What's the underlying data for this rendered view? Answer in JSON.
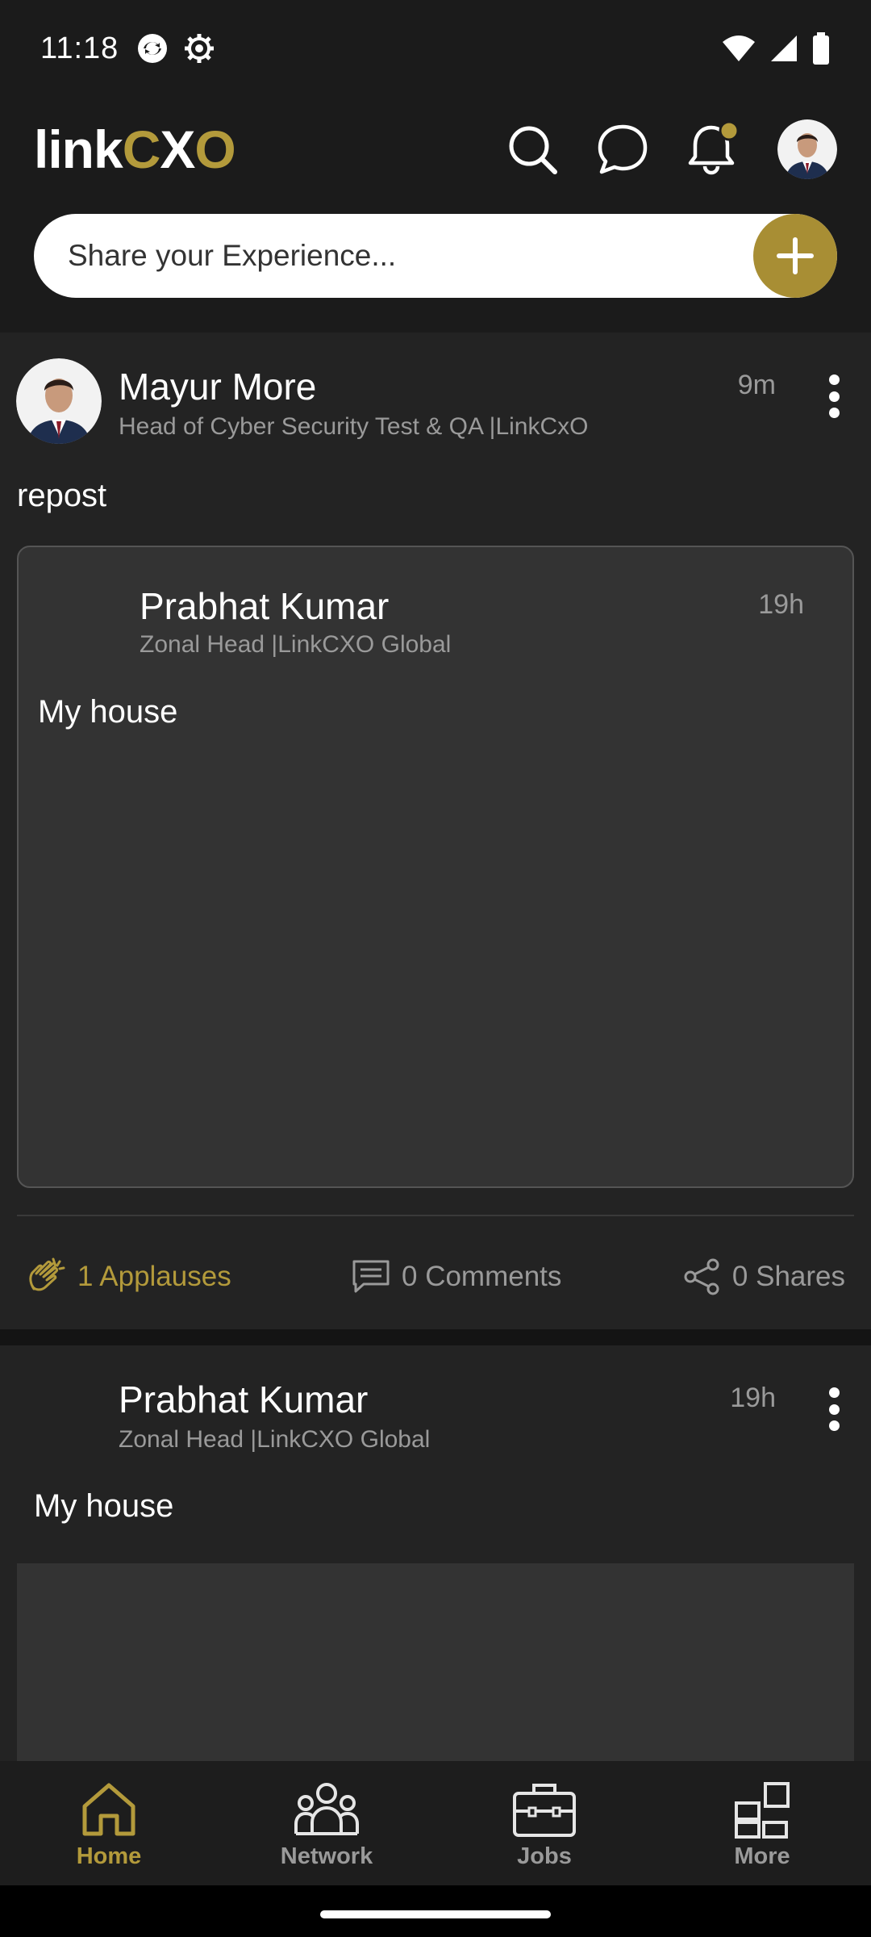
{
  "status_bar": {
    "time": "11:18"
  },
  "header": {
    "logo_part1": "link",
    "logo_part2": "C",
    "logo_part3": "X",
    "logo_part4": "O",
    "share_placeholder": "Share your Experience..."
  },
  "colors": {
    "accent": "#b39a3b",
    "background": "#1b1b1b",
    "card": "#232323"
  },
  "posts": [
    {
      "author": "Mayur More",
      "headline": "Head of Cyber Security Test & QA |LinkCxO",
      "time": "9m",
      "text": "repost",
      "repost": {
        "author": "Prabhat Kumar",
        "headline": "Zonal Head |LinkCXO Global",
        "time": "19h",
        "text": "My house"
      },
      "applauses": "1 Applauses",
      "comments": "0 Comments",
      "shares": "0 Shares"
    },
    {
      "author": "Prabhat Kumar",
      "headline": "Zonal Head |LinkCXO Global",
      "time": "19h",
      "text": "My house"
    }
  ],
  "nav": {
    "items": [
      {
        "label": "Home",
        "icon": "home-icon",
        "active": true
      },
      {
        "label": "Network",
        "icon": "network-icon",
        "active": false
      },
      {
        "label": "Jobs",
        "icon": "jobs-icon",
        "active": false
      },
      {
        "label": "More",
        "icon": "more-icon",
        "active": false
      }
    ]
  }
}
